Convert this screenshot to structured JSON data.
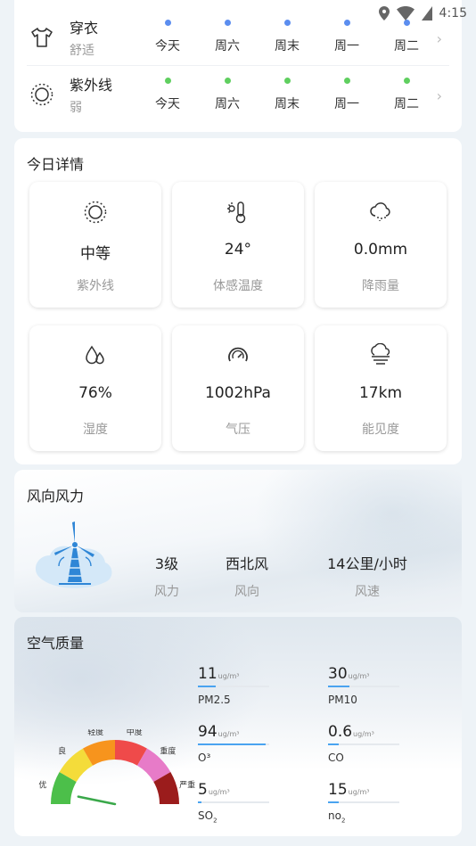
{
  "status": {
    "time": "4:15"
  },
  "index": {
    "rows": [
      {
        "name": "穿衣",
        "level": "舒适",
        "icon": "shirt-icon",
        "dot_color": "#5b8def"
      },
      {
        "name": "紫外线",
        "level": "弱",
        "icon": "sun-icon",
        "dot_color": "#5fcf5f"
      }
    ],
    "days": [
      "今天",
      "周六",
      "周末",
      "周一",
      "周二"
    ]
  },
  "details": {
    "title": "今日详情",
    "tiles": [
      {
        "value": "中等",
        "label": "紫外线",
        "icon": "sun-icon"
      },
      {
        "value": "24°",
        "label": "体感温度",
        "icon": "thermometer-icon"
      },
      {
        "value": "0.0mm",
        "label": "降雨量",
        "icon": "rain-cloud-icon"
      },
      {
        "value": "76%",
        "label": "湿度",
        "icon": "droplets-icon"
      },
      {
        "value": "1002hPa",
        "label": "气压",
        "icon": "gauge-icon"
      },
      {
        "value": "17km",
        "label": "能见度",
        "icon": "fog-icon"
      }
    ]
  },
  "wind": {
    "title": "风向风力",
    "level": {
      "value": "3级",
      "label": "风力"
    },
    "direction": {
      "value": "西北风",
      "label": "风向"
    },
    "speed": {
      "value": "14公里/小时",
      "label": "风速"
    }
  },
  "air": {
    "title": "空气质量",
    "gauge_labels": [
      "优",
      "良",
      "轻度",
      "中度",
      "重度",
      "严重"
    ],
    "gauge_colors": [
      "#4cbf4a",
      "#f4dc3a",
      "#f7941d",
      "#ef4a4a",
      "#e77bc8",
      "#9b1c1c"
    ],
    "pollutants": [
      {
        "value": "11",
        "unit": "ug/m³",
        "name": "PM2.5",
        "fraction": 0.25
      },
      {
        "value": "30",
        "unit": "ug/m³",
        "name": "PM10",
        "fraction": 0.3
      },
      {
        "value": "94",
        "unit": "ug/m³",
        "name": "O³",
        "fraction": 0.95
      },
      {
        "value": "0.6",
        "unit": "ug/m³",
        "name": "CO",
        "fraction": 0.15
      },
      {
        "value": "5",
        "unit": "ug/m³",
        "name": "SO",
        "sub": "2",
        "fraction": 0.05
      },
      {
        "value": "15",
        "unit": "ug/m³",
        "name": "no",
        "sub": "2",
        "fraction": 0.15
      }
    ]
  }
}
